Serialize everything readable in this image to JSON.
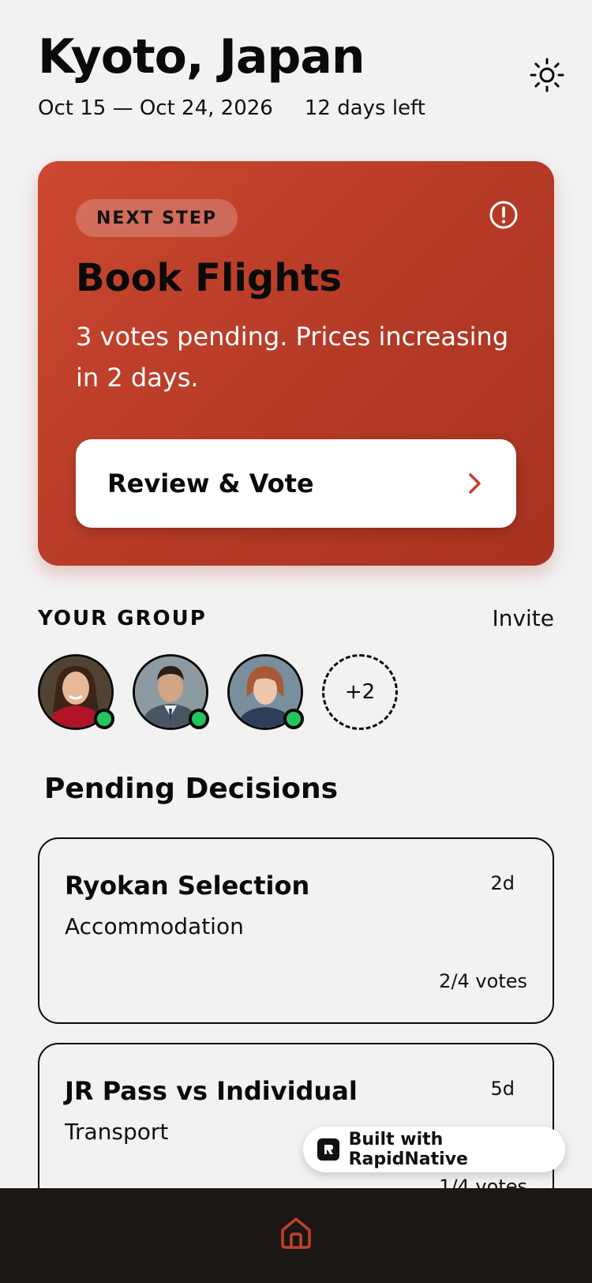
{
  "trip": {
    "title": "Kyoto, Japan",
    "dates": "Oct 15 — Oct 24, 2026",
    "remaining": "12 days left"
  },
  "header": {
    "theme_icon": "sun-icon"
  },
  "next_step": {
    "badge": "NEXT STEP",
    "title": "Book Flights",
    "description": "3 votes pending. Prices increasing in 2 days.",
    "button_label": "Review & Vote",
    "alert_icon": "alert-circle-icon",
    "accent": "#c0412a"
  },
  "group": {
    "title": "YOUR GROUP",
    "invite_label": "Invite",
    "members": [
      {
        "avatar": "woman-red-sweater",
        "online": true
      },
      {
        "avatar": "man-blazer",
        "online": true
      },
      {
        "avatar": "woman-red-hair",
        "online": true
      }
    ],
    "more_label": "+2",
    "online_color": "#22c55e"
  },
  "pending": {
    "title": "Pending Decisions",
    "items": [
      {
        "title": "Ryokan Selection",
        "category": "Accommodation",
        "age": "2d",
        "votes": "2/4 votes"
      },
      {
        "title": "JR Pass vs Individual",
        "category": "Transport",
        "age": "5d",
        "votes": "1/4 votes"
      }
    ]
  },
  "badge": {
    "label": "Built with RapidNative"
  },
  "tabbar": {
    "active": "home-icon",
    "active_color": "#c0412a"
  }
}
